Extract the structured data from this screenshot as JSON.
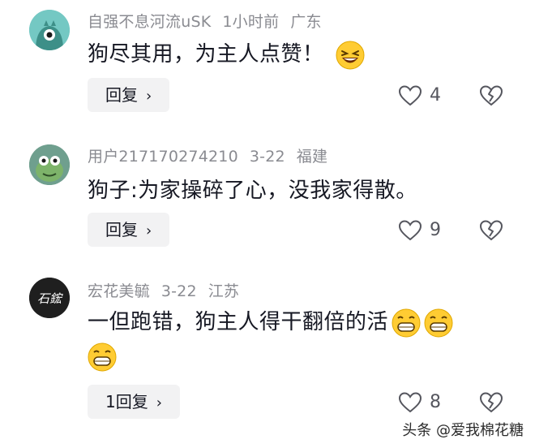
{
  "comments": [
    {
      "username": "自强不息河流uSK",
      "time": "1小时前",
      "location": "广东",
      "text": "狗尽其用，为主人点赞！",
      "reply_label": "回复",
      "like_count": "4",
      "avatar_color": "#6fc5c1"
    },
    {
      "username": "用户217170274210",
      "time": "3-22",
      "location": "福建",
      "text": "狗子:为家操碎了心，没我家得散。",
      "reply_label": "回复",
      "like_count": "9",
      "avatar_color": "#5b8a7a"
    },
    {
      "username": "宏花美毓",
      "time": "3-22",
      "location": "江苏",
      "text": "一但跑错，狗主人得干翻倍的活",
      "reply_label": "1回复",
      "like_count": "8",
      "avatar_color": "#1f1f1f",
      "avatar_text": "石鋐"
    }
  ],
  "watermark": "头条 @爱我棉花糖",
  "icons": {
    "like": "heart-outline-icon",
    "dislike": "broken-heart-icon",
    "chevron": "chevron-right-icon"
  }
}
